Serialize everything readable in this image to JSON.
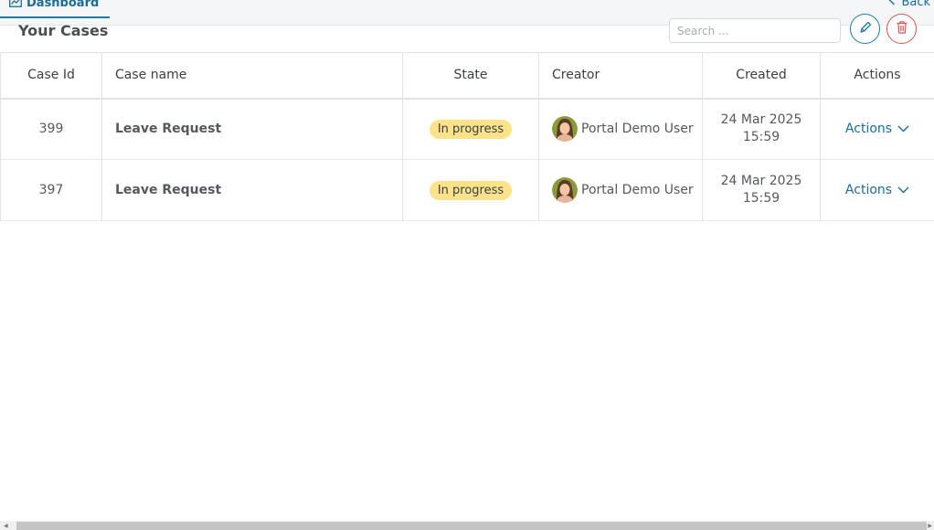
{
  "nav": {
    "dashboard_tab": "Dashboard",
    "back_label": "Back"
  },
  "page": {
    "title": "Your Cases",
    "search_placeholder": "Search ..."
  },
  "table": {
    "headers": {
      "case_id": "Case Id",
      "case_name": "Case name",
      "state": "State",
      "creator": "Creator",
      "created": "Created",
      "actions": "Actions"
    },
    "rows": [
      {
        "id": "399",
        "name": "Leave Request",
        "state": "In progress",
        "creator": "Portal Demo User",
        "created_date": "24 Mar 2025",
        "created_time": "15:59",
        "actions_label": "Actions"
      },
      {
        "id": "397",
        "name": "Leave Request",
        "state": "In progress",
        "creator": "Portal Demo User",
        "created_date": "24 Mar 2025",
        "created_time": "15:59",
        "actions_label": "Actions"
      }
    ]
  },
  "colors": {
    "accent": "#1b6d96",
    "danger": "#d9534f",
    "badge_in_progress": "#fce38a"
  },
  "icons": {
    "dashboard": "dashboard-chart-icon",
    "back": "chevron-left-icon",
    "edit": "pencil-icon",
    "delete": "trash-icon",
    "actions": "chevron-down-icon"
  }
}
